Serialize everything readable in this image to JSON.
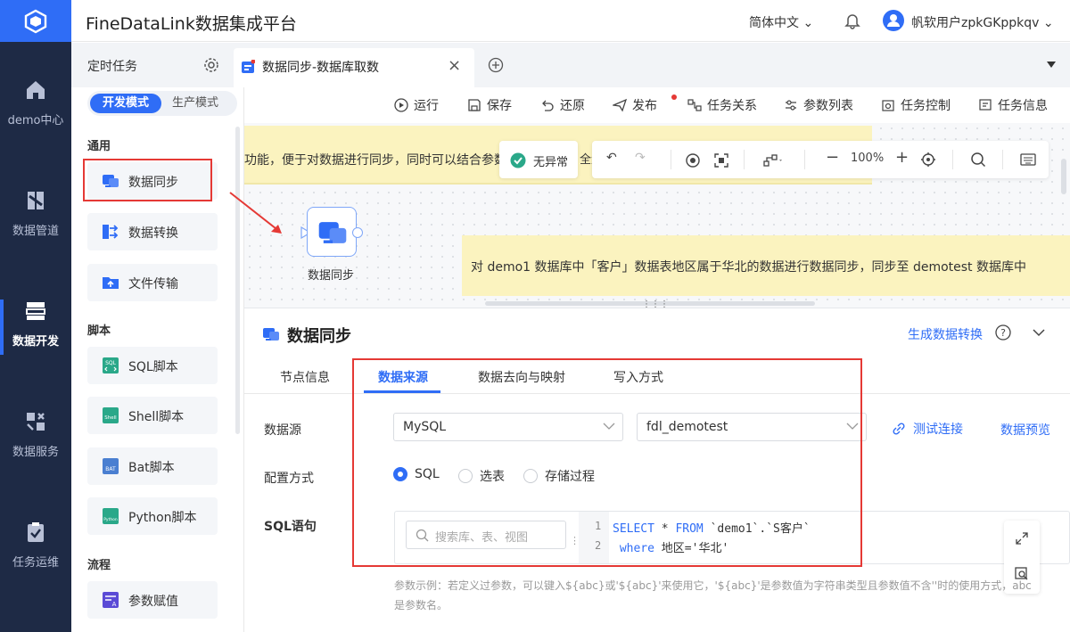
{
  "app": {
    "title": "FineDataLink数据集成平台",
    "language": "简体中文",
    "username": "帆软用户zpkGKppkqv"
  },
  "nav": {
    "items": [
      {
        "label": "demo中心",
        "icon": "home-icon"
      },
      {
        "label": "数据管道",
        "icon": "pipeline-icon"
      },
      {
        "label": "数据开发",
        "icon": "dev-icon"
      },
      {
        "label": "数据服务",
        "icon": "service-icon"
      },
      {
        "label": "任务运维",
        "icon": "ops-icon"
      }
    ]
  },
  "tabs": {
    "scheduled": "定时任务",
    "current": "数据同步-数据库取数"
  },
  "modes": {
    "dev": "开发模式",
    "prod": "生产模式"
  },
  "palette": {
    "sections": {
      "general": "通用",
      "script": "脚本",
      "flow": "流程"
    },
    "general": [
      "数据同步",
      "数据转换",
      "文件传输"
    ],
    "scripts": [
      "SQL脚本",
      "Shell脚本",
      "Bat脚本",
      "Python脚本"
    ],
    "flow": [
      "参数赋值"
    ]
  },
  "toolbar": {
    "run": "运行",
    "save": "保存",
    "restore": "还原",
    "publish": "发布",
    "relation": "任务关系",
    "params": "参数列表",
    "control": "任务控制",
    "info": "任务信息"
  },
  "canvas": {
    "note1": "功能，便于对数据进行同步，同时可以结合参数，",
    "note1_tail": "全量",
    "status": "无异常",
    "zoom": "100%",
    "node_label": "数据同步",
    "note2": "对 demo1 数据库中「客户」数据表地区属于华北的数据进行数据同步，同步至 demotest 数据库中"
  },
  "detail": {
    "title": "数据同步",
    "generate": "生成数据转换",
    "tabs": [
      "节点信息",
      "数据来源",
      "数据去向与映射",
      "写入方式"
    ],
    "labels": {
      "source": "数据源",
      "config": "配置方式",
      "sql": "SQL语句"
    },
    "source_type": "MySQL",
    "source_db": "fdl_demotest",
    "test_conn": "测试连接",
    "preview": "数据预览",
    "config_options": [
      "SQL",
      "选表",
      "存储过程"
    ],
    "search_placeholder": "搜索库、表、视图",
    "sql_lines": [
      {
        "n": "1",
        "kw1": "SELECT",
        "mid": " * ",
        "kw2": "FROM",
        "rest": " `demo1`.`S客户`"
      },
      {
        "n": "2",
        "kw1": " where",
        "mid": " 地区='华北'",
        "kw2": "",
        "rest": ""
      }
    ],
    "hint": "参数示例：若定义过参数，可以键入${abc}或'${abc}'来使用它，'${abc}'是参数值为字符串类型且参数值不含''时的使用方式，abc是参数名。"
  },
  "colors": {
    "accent": "#2f6df6",
    "nav_bg": "#1e2a45",
    "highlight": "#e53935",
    "note": "#fbf3bf"
  }
}
